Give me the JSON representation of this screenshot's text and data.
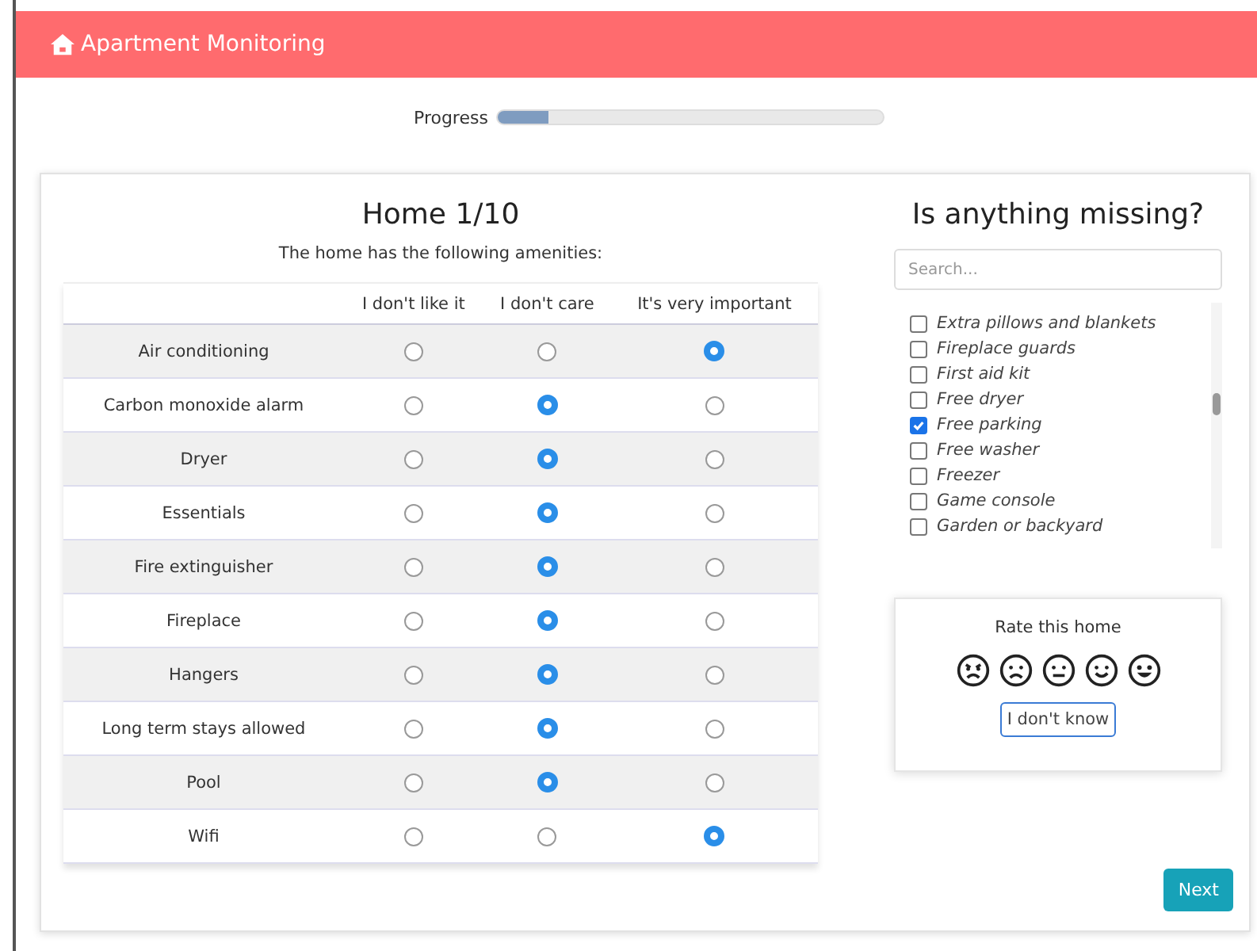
{
  "header": {
    "title": "Apartment Monitoring"
  },
  "progress": {
    "label": "Progress",
    "level": 0.13
  },
  "survey": {
    "title": "Home 1/10",
    "subtitle": "The home has the following amenities:",
    "columns": [
      "I don't like it",
      "I don't care",
      "It's very important"
    ],
    "rows": [
      {
        "label": "Air conditioning",
        "options": [
          {
            "selected": false
          },
          {
            "selected": false
          },
          {
            "selected": true
          }
        ]
      },
      {
        "label": "Carbon monoxide alarm",
        "options": [
          {
            "selected": false
          },
          {
            "selected": true
          },
          {
            "selected": false
          }
        ]
      },
      {
        "label": "Dryer",
        "options": [
          {
            "selected": false
          },
          {
            "selected": true
          },
          {
            "selected": false
          }
        ]
      },
      {
        "label": "Essentials",
        "options": [
          {
            "selected": false
          },
          {
            "selected": true
          },
          {
            "selected": false
          }
        ]
      },
      {
        "label": "Fire extinguisher",
        "options": [
          {
            "selected": false
          },
          {
            "selected": true
          },
          {
            "selected": false
          }
        ]
      },
      {
        "label": "Fireplace",
        "options": [
          {
            "selected": false
          },
          {
            "selected": true
          },
          {
            "selected": false
          }
        ]
      },
      {
        "label": "Hangers",
        "options": [
          {
            "selected": false
          },
          {
            "selected": true
          },
          {
            "selected": false
          }
        ]
      },
      {
        "label": "Long term stays allowed",
        "options": [
          {
            "selected": false
          },
          {
            "selected": true
          },
          {
            "selected": false
          }
        ]
      },
      {
        "label": "Pool",
        "options": [
          {
            "selected": false
          },
          {
            "selected": true
          },
          {
            "selected": false
          }
        ]
      },
      {
        "label": "Wifi",
        "options": [
          {
            "selected": false
          },
          {
            "selected": false
          },
          {
            "selected": true
          }
        ]
      }
    ]
  },
  "missing": {
    "title": "Is anything missing?",
    "search": {
      "placeholder": "Search..."
    },
    "items": [
      {
        "label": "Extra pillows and blankets",
        "checked": false
      },
      {
        "label": "Fireplace guards",
        "checked": false
      },
      {
        "label": "First aid kit",
        "checked": false
      },
      {
        "label": "Free dryer",
        "checked": false
      },
      {
        "label": "Free parking",
        "checked": true
      },
      {
        "label": "Free washer",
        "checked": false
      },
      {
        "label": "Freezer",
        "checked": false
      },
      {
        "label": "Game console",
        "checked": false
      },
      {
        "label": "Garden or backyard",
        "checked": false
      }
    ]
  },
  "rating": {
    "title": "Rate this home",
    "button": "I don't know"
  },
  "next_button": "Next"
}
